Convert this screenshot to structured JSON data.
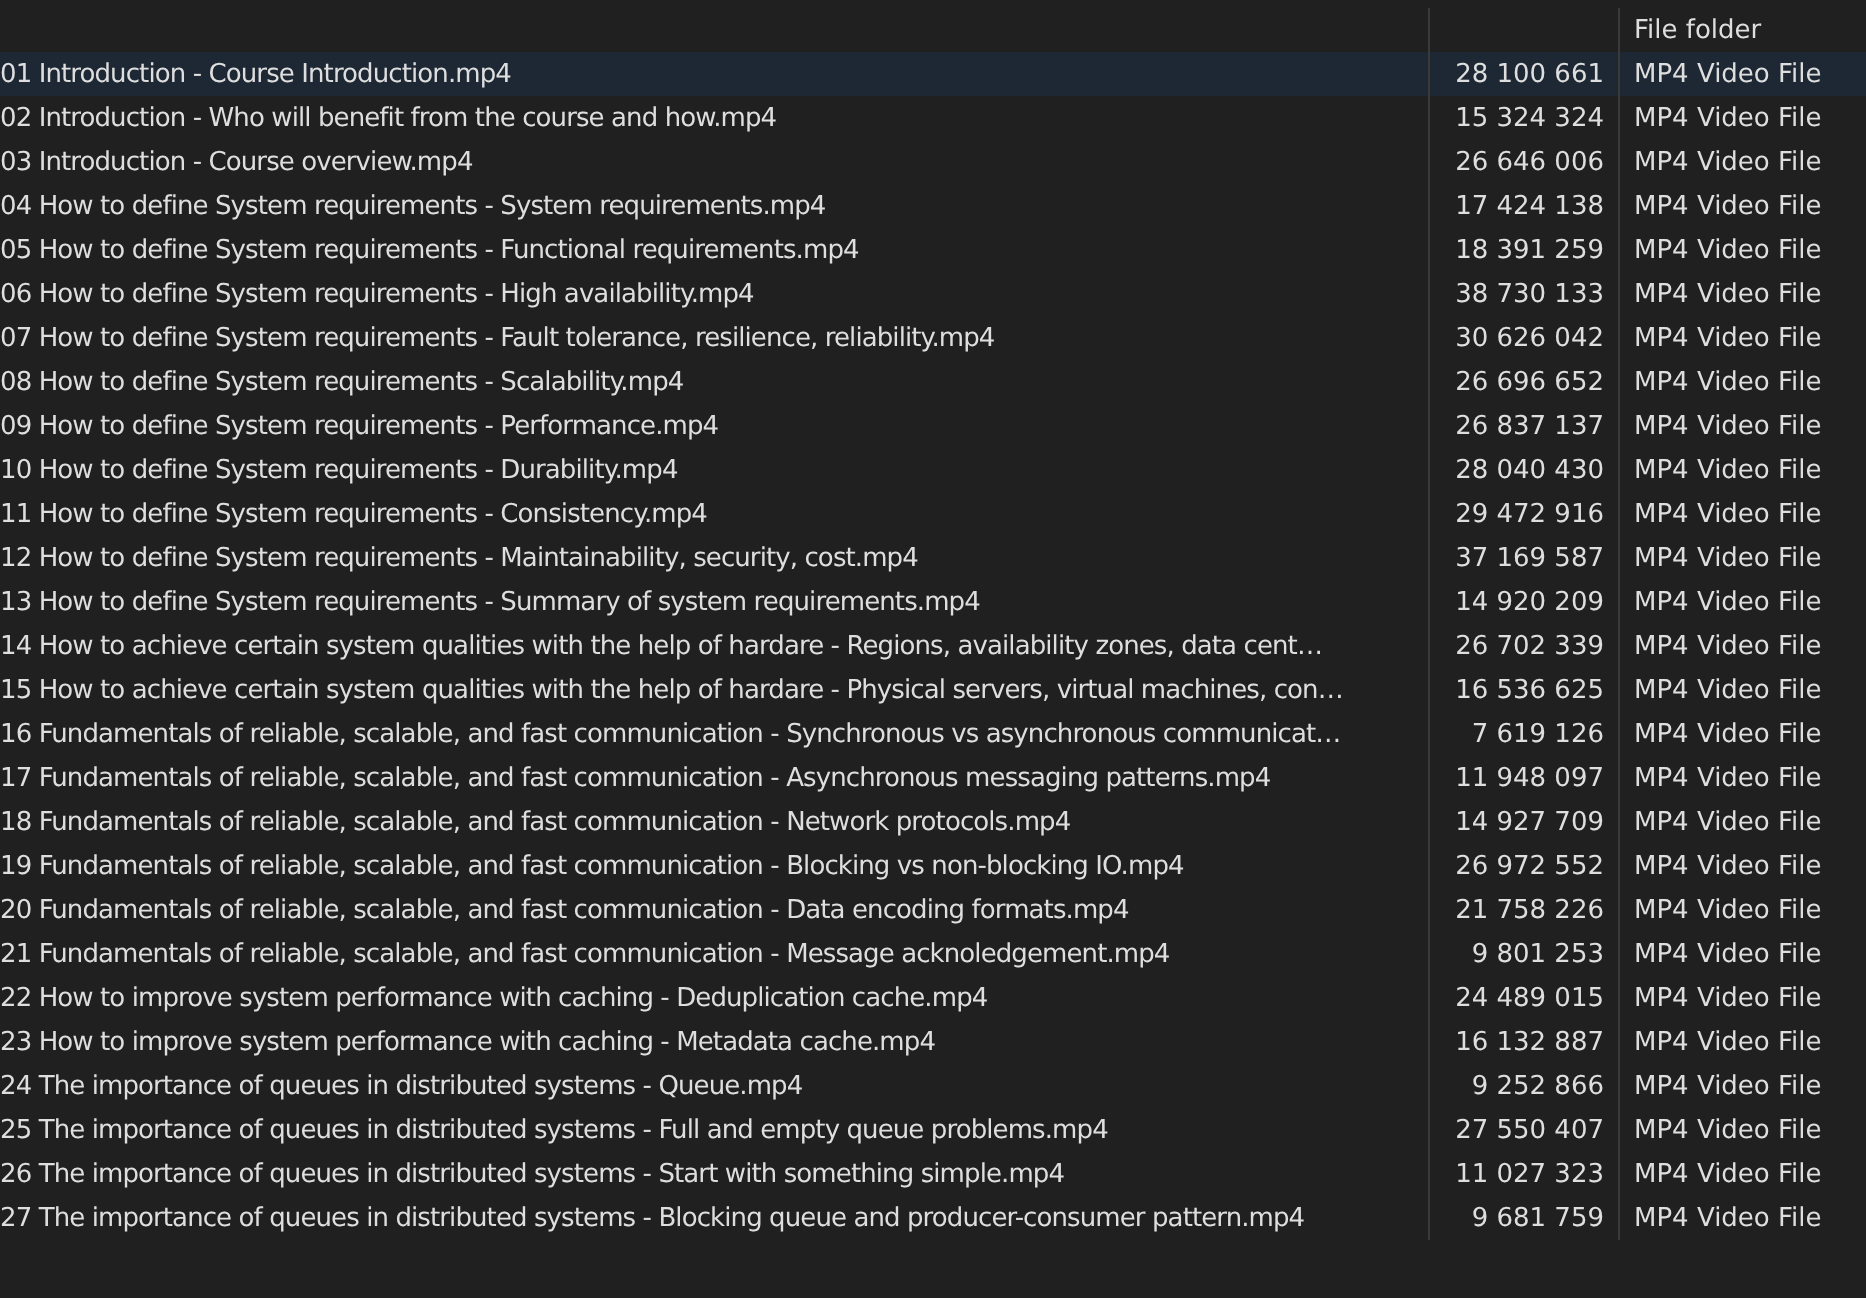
{
  "rows": [
    {
      "name": "",
      "size": "",
      "type": "File folder",
      "selected": false
    },
    {
      "name": "01 Introduction - Course Introduction.mp4",
      "size": "28 100 661",
      "type": "MP4 Video File",
      "selected": true
    },
    {
      "name": "02 Introduction - Who will benefit from the course and how.mp4",
      "size": "15 324 324",
      "type": "MP4 Video File",
      "selected": false
    },
    {
      "name": "03 Introduction - Course overview.mp4",
      "size": "26 646 006",
      "type": "MP4 Video File",
      "selected": false
    },
    {
      "name": "04 How to define System requirements - System requirements.mp4",
      "size": "17 424 138",
      "type": "MP4 Video File",
      "selected": false
    },
    {
      "name": "05 How to define System requirements - Functional requirements.mp4",
      "size": "18 391 259",
      "type": "MP4 Video File",
      "selected": false
    },
    {
      "name": "06 How to define System requirements - High availability.mp4",
      "size": "38 730 133",
      "type": "MP4 Video File",
      "selected": false
    },
    {
      "name": "07 How to define System requirements - Fault tolerance, resilience, reliability.mp4",
      "size": "30 626 042",
      "type": "MP4 Video File",
      "selected": false
    },
    {
      "name": "08 How to define System requirements - Scalability.mp4",
      "size": "26 696 652",
      "type": "MP4 Video File",
      "selected": false
    },
    {
      "name": "09 How to define System requirements - Performance.mp4",
      "size": "26 837 137",
      "type": "MP4 Video File",
      "selected": false
    },
    {
      "name": "10 How to define System requirements - Durability.mp4",
      "size": "28 040 430",
      "type": "MP4 Video File",
      "selected": false
    },
    {
      "name": "11 How to define System requirements - Consistency.mp4",
      "size": "29 472 916",
      "type": "MP4 Video File",
      "selected": false
    },
    {
      "name": "12 How to define System requirements - Maintainability, security, cost.mp4",
      "size": "37 169 587",
      "type": "MP4 Video File",
      "selected": false
    },
    {
      "name": "13 How to define System requirements - Summary of system requirements.mp4",
      "size": "14 920 209",
      "type": "MP4 Video File",
      "selected": false
    },
    {
      "name": "14 How to achieve certain system qualities with the help of hardare - Regions, availability zones, data cent…",
      "size": "26 702 339",
      "type": "MP4 Video File",
      "selected": false
    },
    {
      "name": "15 How to achieve certain system qualities with the help of hardare - Physical servers, virtual machines, con…",
      "size": "16 536 625",
      "type": "MP4 Video File",
      "selected": false
    },
    {
      "name": "16 Fundamentals of reliable, scalable, and fast communication - Synchronous vs asynchronous communicat…",
      "size": "7 619 126",
      "type": "MP4 Video File",
      "selected": false
    },
    {
      "name": "17 Fundamentals of reliable, scalable, and fast communication - Asynchronous messaging patterns.mp4",
      "size": "11 948 097",
      "type": "MP4 Video File",
      "selected": false
    },
    {
      "name": "18 Fundamentals of reliable, scalable, and fast communication - Network protocols.mp4",
      "size": "14 927 709",
      "type": "MP4 Video File",
      "selected": false
    },
    {
      "name": "19 Fundamentals of reliable, scalable, and fast communication - Blocking vs non-blocking IO.mp4",
      "size": "26 972 552",
      "type": "MP4 Video File",
      "selected": false
    },
    {
      "name": "20 Fundamentals of reliable, scalable, and fast communication - Data encoding formats.mp4",
      "size": "21 758 226",
      "type": "MP4 Video File",
      "selected": false
    },
    {
      "name": "21 Fundamentals of reliable, scalable, and fast communication - Message acknoledgement.mp4",
      "size": "9 801 253",
      "type": "MP4 Video File",
      "selected": false
    },
    {
      "name": "22 How to improve system performance with caching - Deduplication cache.mp4",
      "size": "24 489 015",
      "type": "MP4 Video File",
      "selected": false
    },
    {
      "name": "23 How to improve system performance with caching  - Metadata cache.mp4",
      "size": "16 132 887",
      "type": "MP4 Video File",
      "selected": false
    },
    {
      "name": "24 The importance of queues in distributed systems - Queue.mp4",
      "size": "9 252 866",
      "type": "MP4 Video File",
      "selected": false
    },
    {
      "name": "25 The importance of queues in distributed systems - Full and empty queue problems.mp4",
      "size": "27 550 407",
      "type": "MP4 Video File",
      "selected": false
    },
    {
      "name": "26 The importance of queues in distributed systems - Start with something simple.mp4",
      "size": "11 027 323",
      "type": "MP4 Video File",
      "selected": false
    },
    {
      "name": "27 The importance of queues in distributed systems - Blocking queue and producer-consumer pattern.mp4",
      "size": "9 681 759",
      "type": "MP4 Video File",
      "selected": false
    }
  ]
}
